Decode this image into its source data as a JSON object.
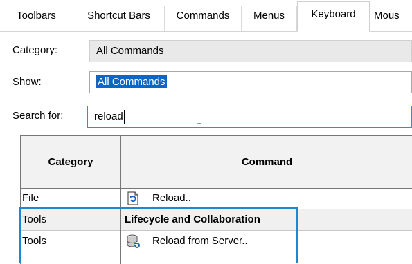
{
  "tabs": [
    {
      "label": "Toolbars",
      "active": false
    },
    {
      "label": "Shortcut Bars",
      "active": false
    },
    {
      "label": "Commands",
      "active": false
    },
    {
      "label": "Menus",
      "active": false
    },
    {
      "label": "Keyboard",
      "active": true
    },
    {
      "label": "Mous",
      "active": false
    }
  ],
  "form": {
    "category_label": "Category:",
    "category_value": "All Commands",
    "show_label": "Show:",
    "show_value": "All Commands",
    "search_label": "Search for:",
    "search_value": "reload"
  },
  "grid": {
    "columns": [
      "Category",
      "Command"
    ],
    "rows": [
      {
        "category": "File",
        "command": "Reload..",
        "icon": "reload-document-icon",
        "group": false
      },
      {
        "category": "Tools",
        "command": "Lifecycle and Collaboration",
        "icon": "",
        "group": true
      },
      {
        "category": "Tools",
        "command": "Reload from Server..",
        "icon": "server-reload-icon",
        "group": false
      }
    ]
  },
  "colors": {
    "highlight": "#1d87d3",
    "selection": "#0a66c8",
    "search_border": "#3b8ad6"
  }
}
